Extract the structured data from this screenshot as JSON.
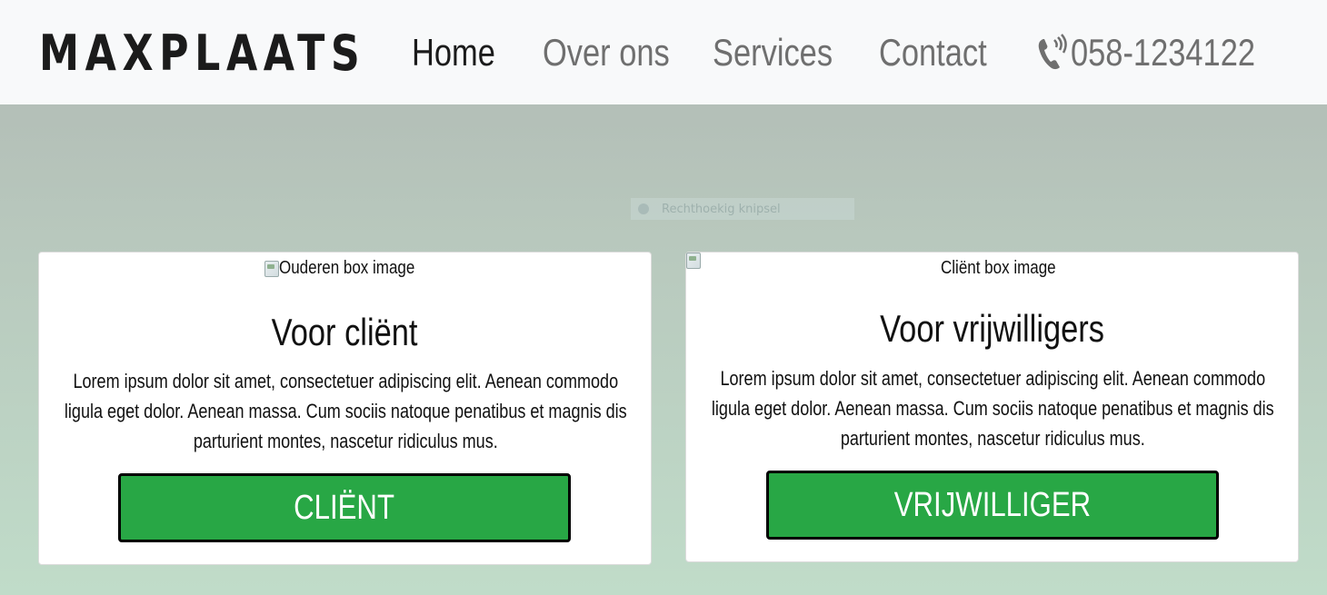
{
  "navbar": {
    "brand": "MAXPLAATS",
    "links": [
      {
        "label": "Home",
        "active": true
      },
      {
        "label": "Over ons",
        "active": false
      },
      {
        "label": "Services",
        "active": false
      },
      {
        "label": "Contact",
        "active": false
      }
    ],
    "phone": {
      "icon": "phone-icon",
      "number": "058-1234122"
    }
  },
  "overlay": {
    "label": "Rechthoekig knipsel"
  },
  "cards": [
    {
      "image_alt": "Ouderen box image",
      "title": "Voor cliënt",
      "text": "Lorem ipsum dolor sit amet, consectetuer adipiscing elit. Aenean commodo ligula eget dolor. Aenean massa. Cum sociis natoque penatibus et magnis dis parturient montes, nascetur ridiculus mus.",
      "button": "CLIËNT"
    },
    {
      "image_alt": "Cliënt box image",
      "title": "Voor vrijwilligers",
      "text": "Lorem ipsum dolor sit amet, consectetuer adipiscing elit. Aenean commodo ligula eget dolor. Aenean massa. Cum sociis natoque penatibus et magnis dis parturient montes, nascetur ridiculus mus.",
      "button": "VRIJWILLIGER"
    }
  ],
  "colors": {
    "navbar_bg": "#f8f9fa",
    "button_bg": "#28a745",
    "text_dark": "#1b1b1b",
    "text_muted": "#6f6f6f"
  }
}
